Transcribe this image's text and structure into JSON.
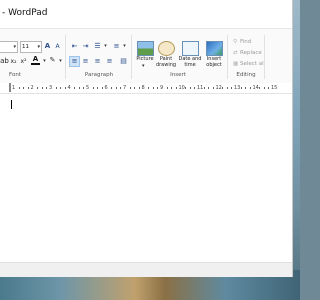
{
  "window": {
    "title": "- WordPad"
  },
  "ribbon": {
    "font": {
      "family_value": "",
      "size_value": "11",
      "label": "Font"
    },
    "paragraph": {
      "label": "Paragraph"
    },
    "insert": {
      "label": "Insert",
      "picture": "Picture",
      "paint_drawing": "Paint drawing",
      "date_time": "Date and time",
      "insert_object": "Insert object"
    },
    "editing": {
      "label": "Editing",
      "find": "Find",
      "replace": "Replace",
      "select_all": "Select all"
    }
  },
  "ruler": {
    "numbers": [
      "1",
      "2",
      "3",
      "4",
      "5",
      "6",
      "7",
      "8",
      "9",
      "10",
      "11",
      "12",
      "13",
      "14",
      "15"
    ]
  },
  "colors": {
    "accent": "#2b579a"
  }
}
